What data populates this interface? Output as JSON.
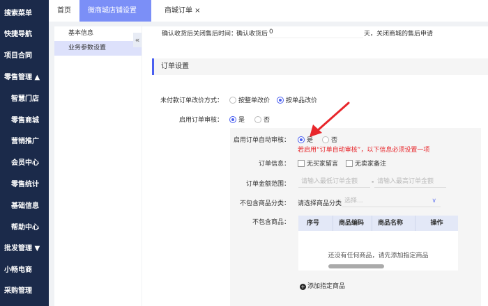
{
  "sidebar": {
    "items": [
      "搜索菜单",
      "快捷导航",
      "项目合同",
      "零售管理 ▲",
      "智慧门店",
      "零售商城",
      "营销推广",
      "会员中心",
      "零售统计",
      "基础信息",
      "帮助中心",
      "批发管理 ▼",
      "小畅电商",
      "采购管理"
    ]
  },
  "tabs": [
    {
      "label": "首页"
    },
    {
      "label": "微商城店铺设置 ×"
    },
    {
      "label": "商城订单 ×"
    }
  ],
  "left_panel": {
    "items": [
      "基本信息",
      "业务参数设置"
    ],
    "collapse": "«"
  },
  "after_sale": {
    "label": "确认收货后关闭售后时间：",
    "prefix": "确认收货后",
    "value": "0",
    "suffix": "天，关闭商城的售后申请"
  },
  "section_title": "订单设置",
  "price_change": {
    "label": "未付款订单改价方式：",
    "options": [
      "按整单改价",
      "按单品改价"
    ]
  },
  "review": {
    "label": "启用订单审核：",
    "options": [
      "是",
      "否"
    ]
  },
  "auto_review": {
    "label": "启用订单自动审核：",
    "options": [
      "是",
      "否"
    ],
    "warning": "若启用“订单自动审核”，以下信息必须设置一项"
  },
  "order_info": {
    "label": "订单信息：",
    "options": [
      "无买家留言",
      "无卖家备注"
    ]
  },
  "amount": {
    "label": "订单金额范围：",
    "min_placeholder": "请输入最低订单金额",
    "sep": "-",
    "max_placeholder": "请输入最高订单金额"
  },
  "category": {
    "label": "不包含商品分类：",
    "prefix": "请选择商品分类",
    "placeholder": "选择..."
  },
  "goods": {
    "label": "不包含商品：",
    "columns": [
      "序号",
      "商品编码",
      "商品名称",
      "操作"
    ],
    "empty": "还没有任何商品，请先添加指定商品",
    "add": "添加指定商品"
  },
  "colors": {
    "sidebar": "#1b2a4a",
    "accent": "#7b8ff7",
    "warning": "#e8262b"
  }
}
